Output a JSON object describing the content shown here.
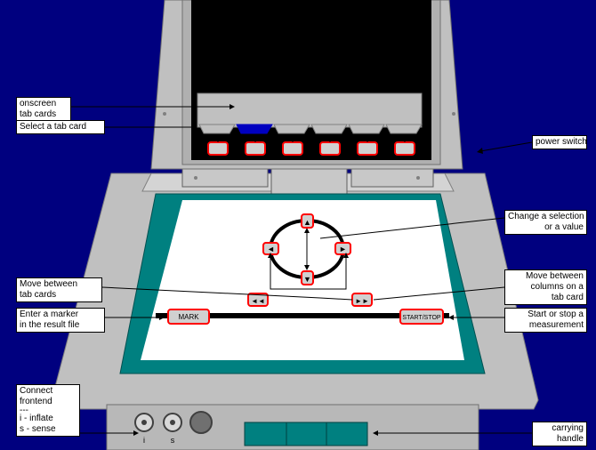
{
  "colors": {
    "background": "#00007f",
    "device_gray": "#c0c0c0",
    "screen": "#000000",
    "teal_mat": "#008080",
    "key_red": "#ff0000",
    "selected_tab": "#0000c0"
  },
  "callouts": {
    "onscreen_tab_cards": [
      "onscreen",
      "tab cards"
    ],
    "select_tab_card": [
      "Select a tab card"
    ],
    "power_switch": [
      "power switch"
    ],
    "change_selection": [
      "Change a selection",
      "or a value"
    ],
    "move_tab_cards": [
      "Move between",
      "tab cards"
    ],
    "move_columns": [
      "Move between",
      "columns on a",
      "tab card"
    ],
    "enter_marker": [
      "Enter a marker",
      "in the result file"
    ],
    "start_stop": [
      "Start or stop a",
      "measurement"
    ],
    "connect_frontend": [
      "Connect",
      "frontend",
      "---",
      "i - inflate",
      "s - sense"
    ],
    "carrying_handle": [
      "carrying",
      "handle"
    ]
  },
  "keys": {
    "mark": "MARK",
    "start_stop": "START/STOP",
    "up": "▲",
    "down": "▼",
    "left": "◄",
    "right": "►",
    "prev": "◄◄",
    "next": "►►"
  },
  "connectors": {
    "inflate": "i",
    "sense": "s"
  }
}
